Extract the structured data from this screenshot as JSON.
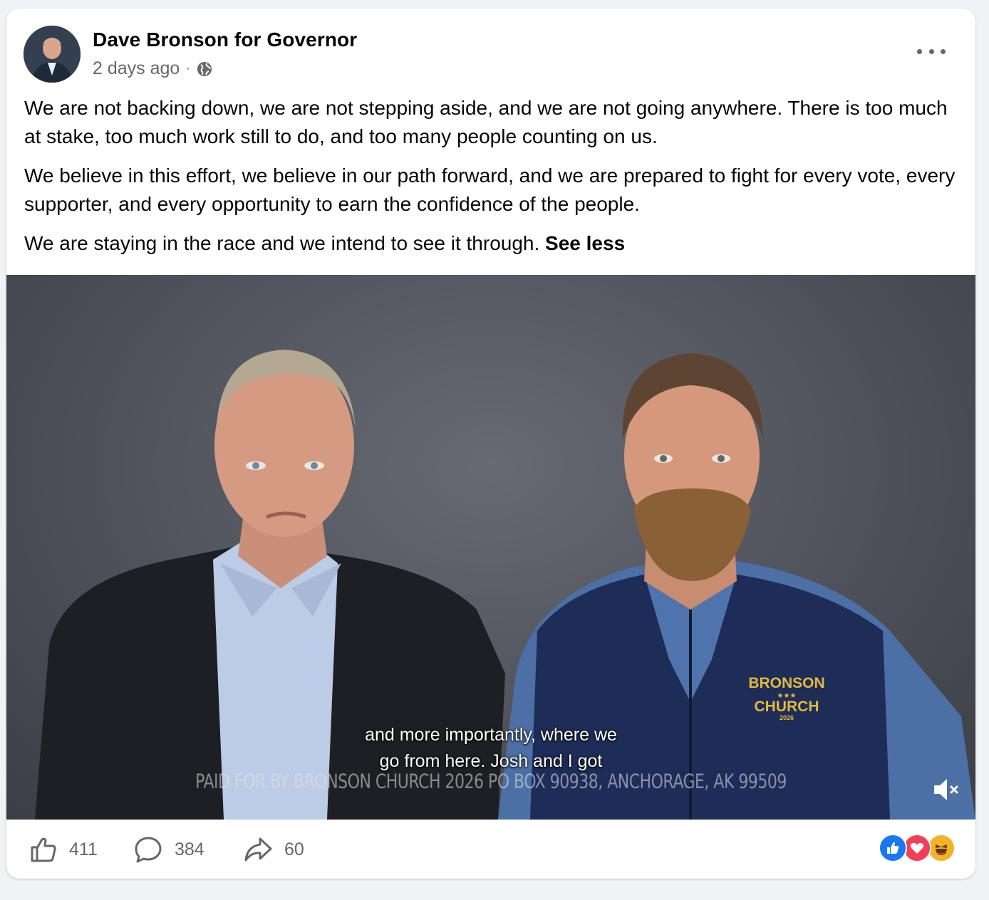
{
  "post": {
    "author": "Dave Bronson for Governor",
    "timestamp": "2 days ago",
    "separator": "·",
    "paragraphs": [
      "We are not backing down, we are not stepping aside, and we are not going anywhere. There is too much at stake, too much work still to do, and too many people counting on us.",
      "We believe in this effort, we believe in our path forward, and we are prepared to fight for every vote, every supporter, and every opportunity to earn the confidence of the people.",
      "We are staying in the race and we intend to see it through."
    ],
    "see_less": "See less"
  },
  "video": {
    "caption_line1": "and more importantly, where we",
    "caption_line2": "go from here. Josh and I got",
    "disclaimer": "PAID FOR BY BRONSON CHURCH 2026 PO BOX 90938, ANCHORAGE, AK 99509",
    "vest_logo_top": "BRONSON",
    "vest_logo_stars": "★★★",
    "vest_logo_bottom": "CHURCH",
    "vest_logo_year": "2026",
    "muted": true
  },
  "actions": {
    "likes": "411",
    "comments": "384",
    "shares": "60"
  },
  "reactions": [
    "like-icon",
    "love-icon",
    "haha-icon"
  ],
  "colors": {
    "like_blue": "#1877f2",
    "love_red": "#f33e58",
    "haha_yellow": "#f7b125",
    "muted_text": "#65676b"
  }
}
